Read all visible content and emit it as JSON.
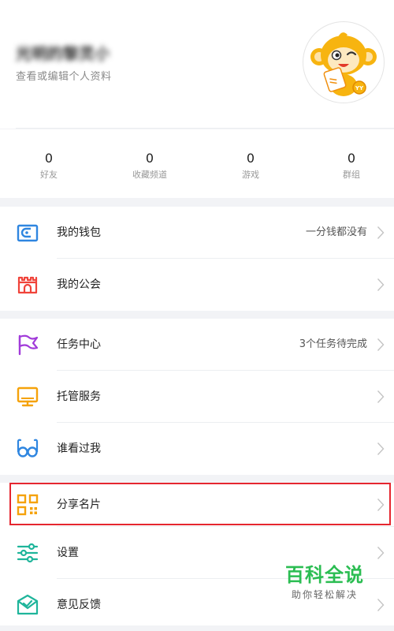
{
  "profile": {
    "username": "光明的黎灵小",
    "subtitle": "查看或编辑个人资料"
  },
  "stats": [
    {
      "value": "0",
      "label": "好友"
    },
    {
      "value": "0",
      "label": "收藏频道"
    },
    {
      "value": "0",
      "label": "游戏"
    },
    {
      "value": "0",
      "label": "群组"
    }
  ],
  "menu": {
    "wallet": {
      "label": "我的钱包",
      "right": "一分钱都没有",
      "icon": "wallet-icon"
    },
    "guild": {
      "label": "我的公会",
      "icon": "castle-icon"
    },
    "tasks": {
      "label": "任务中心",
      "right": "3个任务待完成",
      "icon": "flag-icon"
    },
    "hosting": {
      "label": "托管服务",
      "icon": "monitor-icon"
    },
    "visitors": {
      "label": "谁看过我",
      "icon": "glasses-icon"
    },
    "share": {
      "label": "分享名片",
      "icon": "qr-code-icon"
    },
    "settings": {
      "label": "设置",
      "icon": "sliders-icon"
    },
    "feedback": {
      "label": "意见反馈",
      "icon": "mail-check-icon"
    }
  },
  "watermark": {
    "title": "百科全说",
    "subtitle": "助你轻松解决"
  },
  "colors": {
    "wallet": "#2f86e0",
    "guild": "#f0433a",
    "tasks": "#a13bd9",
    "hosting": "#f5a20a",
    "visitors": "#2f86e0",
    "share": "#f5a20a",
    "settings": "#1fb59b",
    "feedback": "#1fb59b",
    "highlight": "#e5262f",
    "watermark": "#2bbd52"
  }
}
